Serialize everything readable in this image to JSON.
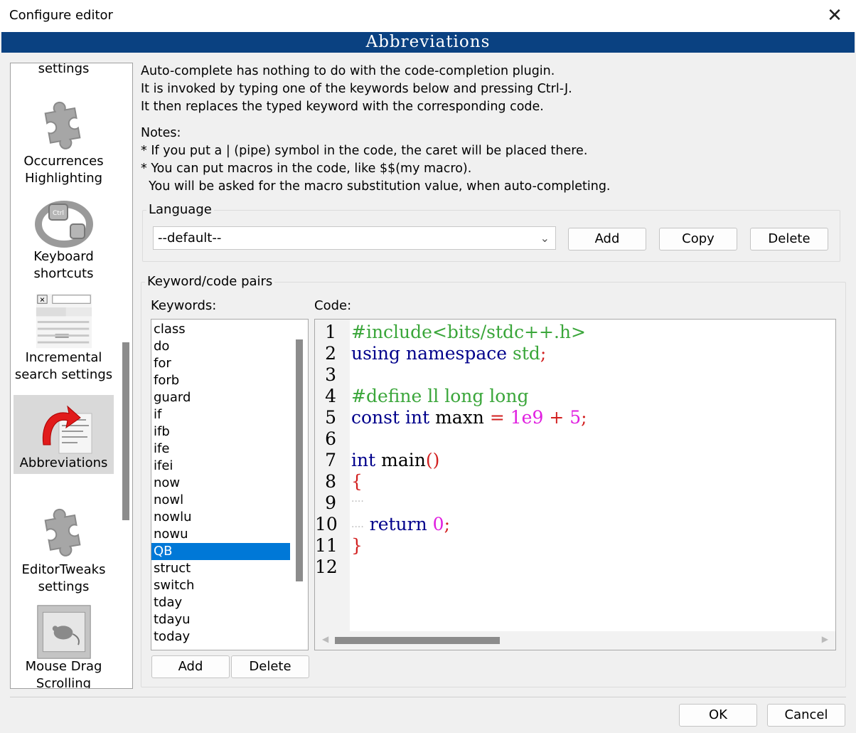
{
  "window": {
    "title": "Configure editor",
    "close_glyph": "✕"
  },
  "banner": {
    "title": "Abbreviations"
  },
  "sidebar": {
    "items": [
      {
        "label": "settings",
        "icon": "puzzle-icon"
      },
      {
        "label": "Occurrences\nHighlighting",
        "icon": "puzzle-icon"
      },
      {
        "label": "Keyboard\nshortcuts",
        "icon": "keyboard-ring-icon"
      },
      {
        "label": "Incremental\nsearch settings",
        "icon": "incremental-search-icon"
      },
      {
        "label": "Abbreviations",
        "icon": "abbreviations-icon",
        "selected": true
      },
      {
        "label": "EditorTweaks\nsettings",
        "icon": "puzzle-icon"
      },
      {
        "label": "Mouse Drag\nScrolling",
        "icon": "mouse-scroll-icon"
      }
    ]
  },
  "description": {
    "line1": "Auto-complete has nothing to do with the code-completion plugin.",
    "line2": "It is invoked by typing one of the keywords below and pressing Ctrl-J.",
    "line3": "It then replaces the typed keyword with the corresponding code.",
    "notes_title": "Notes:",
    "note1": "* If you put a | (pipe) symbol in the code, the caret will be placed there.",
    "note2": "* You can put macros in the code, like $$(my macro).",
    "note3": "  You will be asked for the macro substitution value, when auto-completing."
  },
  "language": {
    "group_label": "Language",
    "selected": "--default--",
    "add_label": "Add",
    "copy_label": "Copy",
    "delete_label": "Delete"
  },
  "pairs": {
    "group_label": "Keyword/code pairs",
    "keywords_label": "Keywords:",
    "code_label": "Code:",
    "keywords": [
      "class",
      "do",
      "for",
      "forb",
      "guard",
      "if",
      "ifb",
      "ife",
      "ifei",
      "now",
      "nowl",
      "nowlu",
      "nowu",
      "QB",
      "struct",
      "switch",
      "tday",
      "tdayu",
      "today"
    ],
    "selected_keyword": "QB",
    "add_label": "Add",
    "delete_label": "Delete"
  },
  "code": {
    "line_numbers": [
      "1",
      "2",
      "3",
      "4",
      "5",
      "6",
      "7",
      "8",
      "9",
      "10",
      "11",
      "12"
    ],
    "l1": "#include<bits/stdc++.h>",
    "l2_kw1": "using",
    "l2_kw2": "namespace",
    "l2_std": "std",
    "l2_semi": ";",
    "l4": "#define ll long long",
    "l5_kw1": "const",
    "l5_kw2": "int",
    "l5_id": "maxn",
    "l5_eq": "=",
    "l5_num": "1e9",
    "l5_plus": "+",
    "l5_num2": "5",
    "l5_semi": ";",
    "l7_kw": "int",
    "l7_id": "main",
    "l7_paren": "()",
    "l8": "{",
    "l9": "····",
    "l10_dots": "····",
    "l10_kw": "return",
    "l10_num": "0",
    "l10_semi": ";",
    "l11": "}"
  },
  "footer": {
    "ok_label": "OK",
    "cancel_label": "Cancel"
  }
}
